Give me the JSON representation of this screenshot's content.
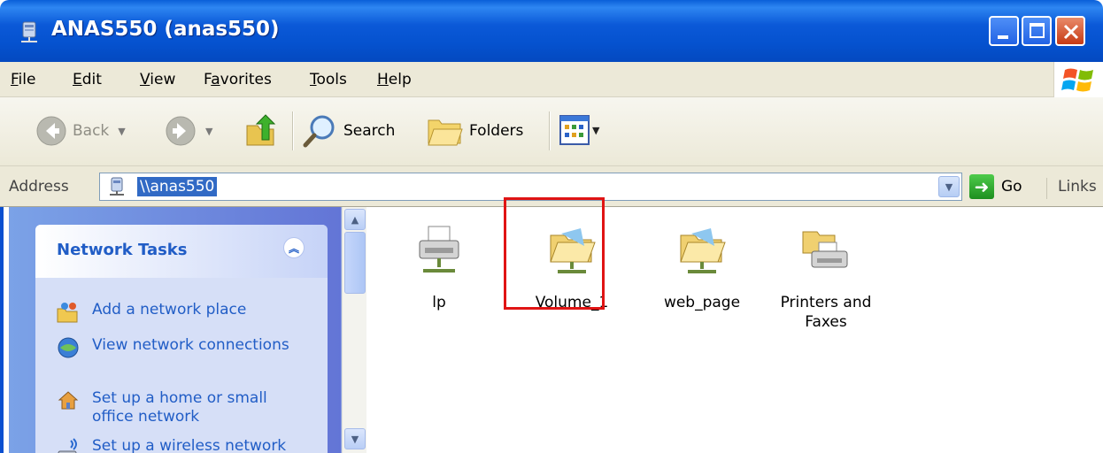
{
  "window": {
    "title": "ANAS550 (anas550)"
  },
  "menu": {
    "items": [
      {
        "acc": "F",
        "rest": "ile"
      },
      {
        "acc": "E",
        "rest": "dit"
      },
      {
        "acc": "V",
        "rest": "iew"
      },
      {
        "pre": "F",
        "acc": "a",
        "rest": "vorites"
      },
      {
        "acc": "T",
        "rest": "ools"
      },
      {
        "acc": "H",
        "rest": "elp"
      }
    ]
  },
  "toolbar": {
    "back_label": "Back",
    "search_label": "Search",
    "folders_label": "Folders"
  },
  "address": {
    "label": "Address",
    "value": "\\\\anas550",
    "go_label": "Go",
    "links_label": "Links"
  },
  "tasks": {
    "title": "Network Tasks",
    "items": [
      {
        "label": "Add a network place",
        "icon": "add-network-place-icon"
      },
      {
        "label": "View network connections",
        "icon": "view-network-connections-icon"
      },
      {
        "label": "Set up a home or small office network",
        "icon": "home-network-icon"
      },
      {
        "label": "Set up a wireless network for a home or",
        "icon": "wireless-network-icon"
      }
    ]
  },
  "files": [
    {
      "label": "lp",
      "icon": "shared-printer-icon"
    },
    {
      "label": "Volume_1",
      "icon": "shared-folder-icon"
    },
    {
      "label": "web_page",
      "icon": "shared-folder-icon"
    },
    {
      "label": "Printers and Faxes",
      "icon": "printers-faxes-icon"
    }
  ],
  "colors": {
    "titlebar": "#0a5fd9",
    "task_link": "#215dc6",
    "selection": "#316ac5",
    "highlight_box": "#e01414"
  }
}
